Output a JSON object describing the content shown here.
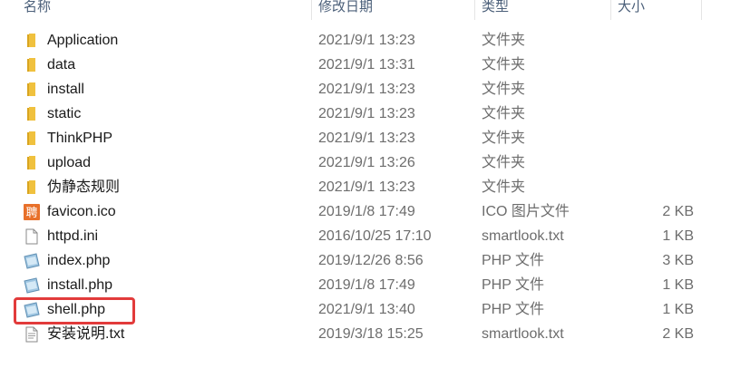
{
  "columns": {
    "name": "名称",
    "modified": "修改日期",
    "type": "类型",
    "size": "大小"
  },
  "files": [
    {
      "name": "Application",
      "date": "2021/9/1 13:23",
      "type": "文件夹",
      "size": "",
      "icon": "folder-icon"
    },
    {
      "name": "data",
      "date": "2021/9/1 13:31",
      "type": "文件夹",
      "size": "",
      "icon": "folder-icon"
    },
    {
      "name": "install",
      "date": "2021/9/1 13:23",
      "type": "文件夹",
      "size": "",
      "icon": "folder-icon"
    },
    {
      "name": "static",
      "date": "2021/9/1 13:23",
      "type": "文件夹",
      "size": "",
      "icon": "folder-icon"
    },
    {
      "name": "ThinkPHP",
      "date": "2021/9/1 13:23",
      "type": "文件夹",
      "size": "",
      "icon": "folder-icon"
    },
    {
      "name": "upload",
      "date": "2021/9/1 13:26",
      "type": "文件夹",
      "size": "",
      "icon": "folder-icon"
    },
    {
      "name": "伪静态规则",
      "date": "2021/9/1 13:23",
      "type": "文件夹",
      "size": "",
      "icon": "folder-icon"
    },
    {
      "name": "favicon.ico",
      "date": "2019/1/8 17:49",
      "type": "ICO 图片文件",
      "size": "2 KB",
      "icon": "ico-image-icon",
      "icon_glyph": "聘"
    },
    {
      "name": "httpd.ini",
      "date": "2016/10/25 17:10",
      "type": "smartlook.txt",
      "size": "1 KB",
      "icon": "ini-file-icon"
    },
    {
      "name": "index.php",
      "date": "2019/12/26 8:56",
      "type": "PHP 文件",
      "size": "3 KB",
      "icon": "php-file-icon"
    },
    {
      "name": "install.php",
      "date": "2019/1/8 17:49",
      "type": "PHP 文件",
      "size": "1 KB",
      "icon": "php-file-icon"
    },
    {
      "name": "shell.php",
      "date": "2021/9/1 13:40",
      "type": "PHP 文件",
      "size": "1 KB",
      "icon": "php-file-icon"
    },
    {
      "name": "安装说明.txt",
      "date": "2019/3/18 15:25",
      "type": "smartlook.txt",
      "size": "2 KB",
      "icon": "text-file-icon"
    }
  ],
  "colors": {
    "folder": "#f0c13e",
    "folder_dark": "#d9a520",
    "highlight": "#e23b3b",
    "ico_bg": "#e8702a"
  }
}
